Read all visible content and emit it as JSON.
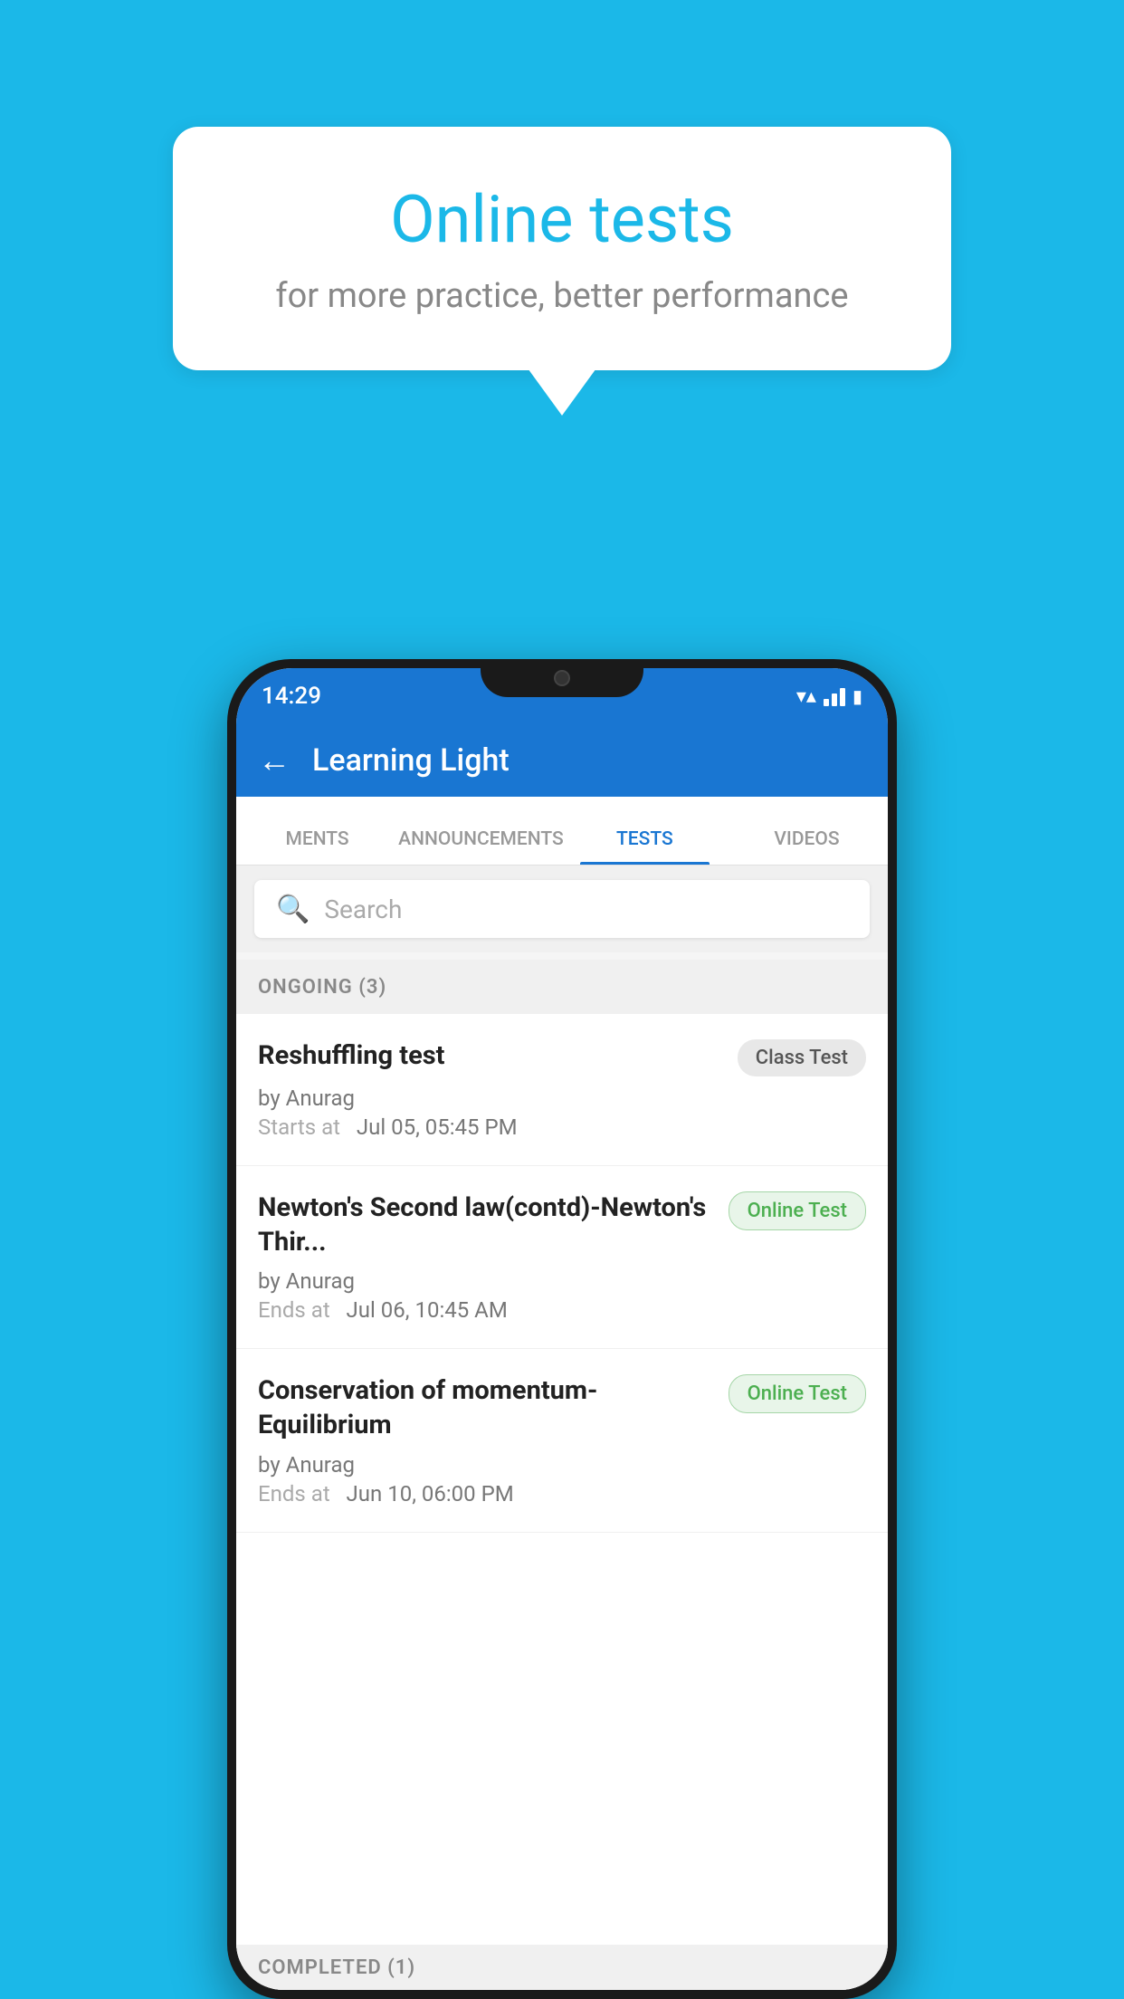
{
  "background": {
    "color": "#1BB8E8"
  },
  "speech_bubble": {
    "title": "Online tests",
    "subtitle": "for more practice, better performance"
  },
  "phone": {
    "status_bar": {
      "time": "14:29",
      "wifi": "▼",
      "battery": "▮"
    },
    "app_bar": {
      "back_label": "←",
      "title": "Learning Light"
    },
    "tabs": [
      {
        "label": "MENTS",
        "active": false
      },
      {
        "label": "ANNOUNCEMENTS",
        "active": false
      },
      {
        "label": "TESTS",
        "active": true
      },
      {
        "label": "VIDEOS",
        "active": false
      }
    ],
    "search": {
      "placeholder": "Search"
    },
    "section_ongoing": {
      "label": "ONGOING (3)"
    },
    "test_items": [
      {
        "name": "Reshuffling test",
        "badge": "Class Test",
        "badge_type": "class",
        "by": "by Anurag",
        "date_label": "Starts at",
        "date": "Jul 05, 05:45 PM"
      },
      {
        "name": "Newton's Second law(contd)-Newton's Thir...",
        "badge": "Online Test",
        "badge_type": "online",
        "by": "by Anurag",
        "date_label": "Ends at",
        "date": "Jul 06, 10:45 AM"
      },
      {
        "name": "Conservation of momentum-Equilibrium",
        "badge": "Online Test",
        "badge_type": "online",
        "by": "by Anurag",
        "date_label": "Ends at",
        "date": "Jun 10, 06:00 PM"
      }
    ],
    "section_completed": {
      "label": "COMPLETED (1)"
    }
  }
}
